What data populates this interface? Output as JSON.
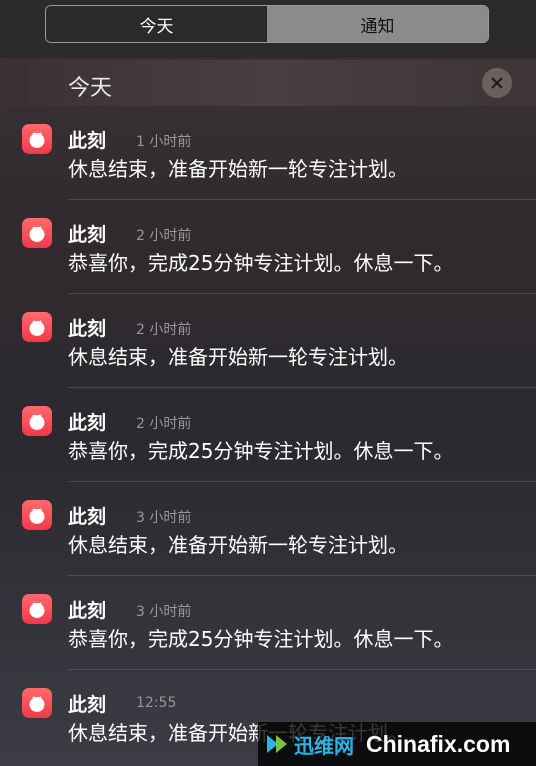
{
  "tabs": [
    {
      "label": "今天",
      "selected": true
    },
    {
      "label": "通知",
      "selected": false
    }
  ],
  "section": {
    "title": "今天",
    "close_icon": "close-icon"
  },
  "notifications": [
    {
      "app": "此刻",
      "time": "1 小时前",
      "message": "休息结束，准备开始新一轮专注计划。"
    },
    {
      "app": "此刻",
      "time": "2 小时前",
      "message": "恭喜你，完成25分钟专注计划。休息一下。"
    },
    {
      "app": "此刻",
      "time": "2 小时前",
      "message": "休息结束，准备开始新一轮专注计划。"
    },
    {
      "app": "此刻",
      "time": "2 小时前",
      "message": "恭喜你，完成25分钟专注计划。休息一下。"
    },
    {
      "app": "此刻",
      "time": "3 小时前",
      "message": "休息结束，准备开始新一轮专注计划。"
    },
    {
      "app": "此刻",
      "time": "3 小时前",
      "message": "恭喜你，完成25分钟专注计划。休息一下。"
    },
    {
      "app": "此刻",
      "time": "12:55",
      "message": "休息结束，准备开始新一轮专注计划。"
    }
  ],
  "watermark": {
    "cn": "迅维网",
    "en": "Chinafix.com"
  },
  "colors": {
    "app_icon": "#f2384a",
    "selected_tab_bg": "#2a292c",
    "unselected_tab_bg": "#8b8a8d",
    "watermark_cn": "#2db3e8"
  }
}
